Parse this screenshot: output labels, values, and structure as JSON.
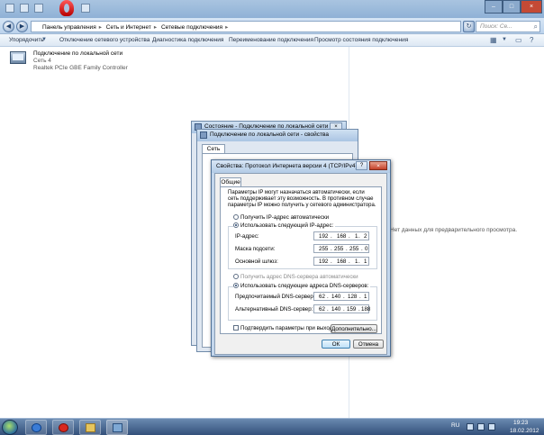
{
  "explorer": {
    "breadcrumb": [
      "Панель управления",
      "Сеть и Интернет",
      "Сетевые подключения"
    ],
    "search_placeholder": "Поиск: Се...",
    "toolbar": [
      "Упорядочить",
      "Отключение сетевого устройства",
      "Диагностика подключения",
      "Переименование подключения",
      "Просмотр состояния подключения"
    ],
    "connection": {
      "name": "Подключение по локальной сети",
      "network": "Сеть 4",
      "device": "Realtek PCIe GBE Family Controller"
    },
    "preview_message": "Нет данных для предварительного просмотра."
  },
  "back_dialogs": {
    "status_title": "Состояние - Подключение по локальной сети",
    "properties_title": "Подключение по локальной сети - свойства",
    "properties_tab": "Сеть"
  },
  "dialog": {
    "title": "Свойства: Протокол Интернета версии 4 (TCP/IPv4)",
    "help": "?",
    "close": "×",
    "tab": "Общие",
    "description": "Параметры IP могут назначаться автоматически, если сеть поддерживает эту возможность. В противном случае параметры IP можно получить у сетевого администратора.",
    "ip_auto": "Получить IP-адрес автоматически",
    "ip_manual": "Использовать следующий IP-адрес:",
    "ip_label": "IP-адрес:",
    "ip_value": [
      "192",
      "168",
      "1",
      "2"
    ],
    "mask_label": "Маска подсети:",
    "mask_value": [
      "255",
      "255",
      "255",
      "0"
    ],
    "gateway_label": "Основной шлюз:",
    "gateway_value": [
      "192",
      "168",
      "1",
      "1"
    ],
    "dns_auto": "Получить адрес DNS-сервера автоматически",
    "dns_manual": "Использовать следующие адреса DNS-серверов:",
    "dns_pref_label": "Предпочитаемый DNS-сервер:",
    "dns_pref_value": [
      "62",
      "140",
      "128",
      "1"
    ],
    "dns_alt_label": "Альтернативный DNS-сервер:",
    "dns_alt_value": [
      "62",
      "140",
      "159",
      "188"
    ],
    "confirm_label": "Подтвердить параметры при выходе",
    "advanced": "Дополнительно...",
    "ok": "ОК",
    "cancel": "Отмена"
  },
  "taskbar": {
    "lang": "RU",
    "time": "19:23",
    "date": "18.02.2012"
  }
}
